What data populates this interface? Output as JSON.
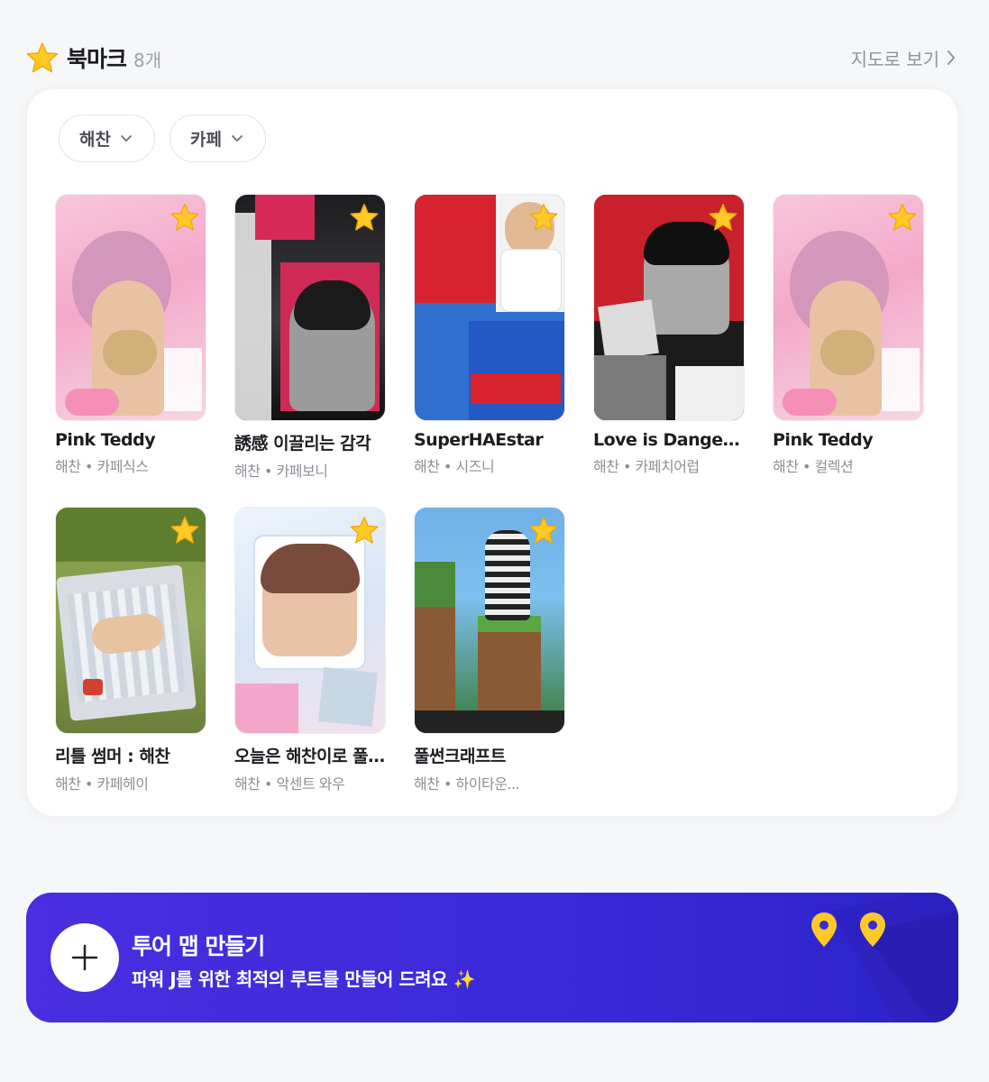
{
  "header": {
    "title": "북마크",
    "count": "8개",
    "map_link": "지도로 보기",
    "star_color": "#FFC928"
  },
  "filters": [
    {
      "label": "해찬"
    },
    {
      "label": "카페"
    }
  ],
  "bookmarks": [
    {
      "title": "Pink Teddy",
      "subtitle": "해찬 • 카페식스"
    },
    {
      "title": "誘感 이끌리는 감각",
      "subtitle": "해찬 • 카페보니"
    },
    {
      "title": "SuperHAEstar",
      "subtitle": "해찬 • 시즈니"
    },
    {
      "title": "Love is Danger...",
      "subtitle": "해찬 • 카페치어럽"
    },
    {
      "title": "Pink Teddy",
      "subtitle": "해찬 • 컬렉션"
    },
    {
      "title": "리틀 썸머 : 해찬",
      "subtitle": "해찬 • 카페헤이"
    },
    {
      "title": "오늘은 해찬이로 풀...",
      "subtitle": "해찬 • 악센트 와우"
    },
    {
      "title": "풀썬크래프트",
      "subtitle": "해찬 • 하이타운..."
    }
  ],
  "banner": {
    "title": "투어 맵 만들기",
    "subtitle": "파워 J를 위한 최적의 루트를 만들어 드려요 ✨",
    "accent": "#3A2AD8",
    "pin_color": "#FFC928"
  }
}
